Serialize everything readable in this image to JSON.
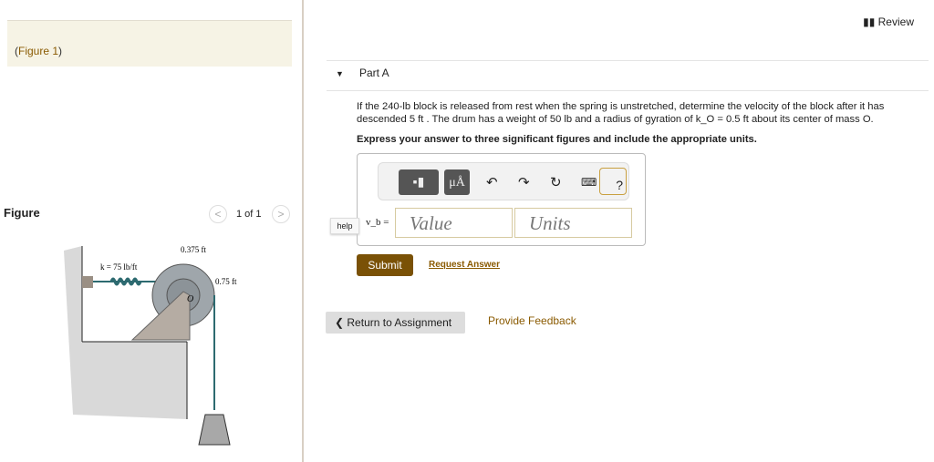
{
  "header": {
    "review_label": "Review"
  },
  "figure_panel": {
    "caption_open": "(",
    "caption_link": "Figure 1",
    "caption_close": ")",
    "title": "Figure",
    "pager": "1 of 1",
    "prev": "<",
    "next": ">",
    "labels": {
      "inner_radius": "0.375 ft",
      "outer_radius": "0.75 ft",
      "spring": "k = 75 lb/ft",
      "center": "O"
    }
  },
  "part": {
    "label": "Part A",
    "question_line1": "If the 240-lb block is released from rest when the spring is unstretched, determine the velocity of the block after it has",
    "question_line2": "descended 5 ft . The drum has a weight of 50 lb and a radius of gyration of k_O = 0.5 ft about its center of mass O.",
    "instruction": "Express your answer to three significant figures and include the appropriate units.",
    "toolbar": {
      "units_btn": "μÅ",
      "help_btn": "?"
    },
    "help_label": "help",
    "variable": "v_b =",
    "value_placeholder": "Value",
    "units_placeholder": "Units",
    "submit": "Submit",
    "request_answer": "Request Answer"
  },
  "footer": {
    "return": "Return to Assignment",
    "feedback": "Provide Feedback"
  }
}
